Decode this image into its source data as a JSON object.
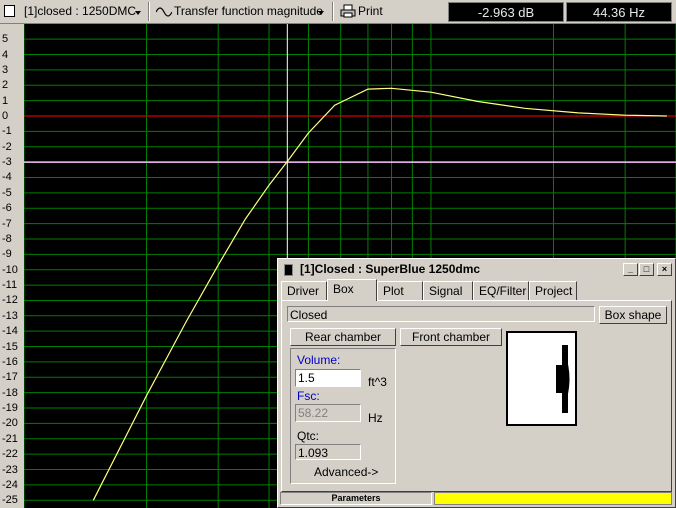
{
  "toolbar": {
    "document_label": "[1]closed : 1250DMC",
    "mode_label": "Transfer function magnitude",
    "print_label": "Print",
    "level_readout": "-2.963 dB",
    "freq_readout": "44.36 Hz"
  },
  "chart_data": {
    "type": "line",
    "xlabel": "",
    "ylabel": "",
    "ylim": [
      -25,
      5.5
    ],
    "y_ticks": [
      "5",
      "4",
      "3",
      "2",
      "1",
      "0",
      "-1",
      "-2",
      "-3",
      "-4",
      "-5",
      "-6",
      "-7",
      "-8",
      "-9",
      "-10",
      "-11",
      "-12",
      "-13",
      "-14",
      "-15",
      "-16",
      "-17",
      "-18",
      "-19",
      "-20",
      "-21",
      "-22",
      "-23",
      "-24",
      "-25"
    ],
    "x_scale": "log",
    "grid": true,
    "colors": {
      "background": "#000000",
      "grid": "#008000",
      "curve": "#ffff80",
      "zero_line": "#ff0000",
      "minus3_line": "#ffc0ff",
      "cursor": "#ffffff"
    },
    "reference_lines": [
      0,
      -3
    ],
    "cursor": {
      "x": 44.36,
      "y": -2.963
    },
    "series": [
      {
        "x": [
          14.8,
          20,
          25,
          30,
          35,
          40,
          44.36,
          50,
          58,
          70,
          80,
          100,
          130,
          170,
          230,
          300,
          380
        ],
        "y": [
          -25,
          -18.2,
          -13.4,
          -9.7,
          -6.7,
          -4.5,
          -2.963,
          -1.1,
          0.7,
          1.75,
          1.8,
          1.55,
          0.95,
          0.5,
          0.2,
          0.05,
          0.0
        ]
      }
    ]
  },
  "dialog": {
    "title": "[1]Closed : SuperBlue 1250dmc",
    "tabs": [
      "Driver",
      "Box",
      "Plot",
      "Signal",
      "EQ/Filter",
      "Project"
    ],
    "active_tab": "Box",
    "box_type": "Closed",
    "box_shape_label": "Box shape",
    "rear_chamber_label": "Rear chamber",
    "front_chamber_label": "Front chamber",
    "volume_label": "Volume:",
    "volume_value": "1.5",
    "volume_unit": "ft^3",
    "fsc_label": "Fsc:",
    "fsc_value": "58.22",
    "fsc_unit": "Hz",
    "qtc_label": "Qtc:",
    "qtc_value": "1.093",
    "advanced_label": "Advanced->",
    "status_label": "Parameters"
  }
}
